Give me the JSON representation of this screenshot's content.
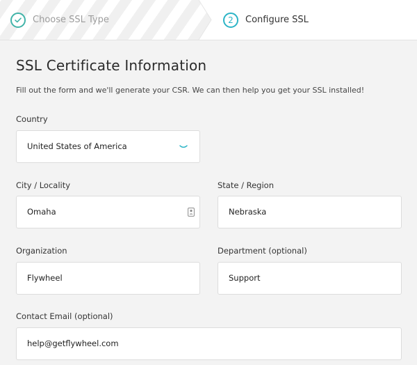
{
  "stepper": {
    "steps": [
      {
        "label": "Choose SSL Type",
        "status": "complete",
        "icon": "check-icon"
      },
      {
        "label": "Configure SSL",
        "status": "current",
        "number": "2"
      }
    ],
    "colors": {
      "complete": "#40b3a8",
      "current": "#2bb4c6"
    }
  },
  "page": {
    "title": "SSL Certificate Information",
    "intro": "Fill out the form and we'll generate your CSR. We can then help you get your SSL installed!"
  },
  "form": {
    "country": {
      "label": "Country",
      "value": "United States of America",
      "icon": "chevron-down-icon"
    },
    "city": {
      "label": "City / Locality",
      "value": "Omaha",
      "icon": "contact-card-icon"
    },
    "state": {
      "label": "State / Region",
      "value": "Nebraska"
    },
    "organization": {
      "label": "Organization",
      "value": "Flywheel"
    },
    "department": {
      "label": "Department (optional)",
      "value": "Support"
    },
    "email": {
      "label": "Contact Email (optional)",
      "value": "help@getflywheel.com"
    }
  }
}
